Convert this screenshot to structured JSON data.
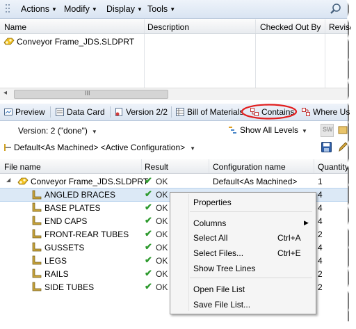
{
  "menubar": {
    "items": [
      {
        "label": "Actions"
      },
      {
        "label": "Modify"
      },
      {
        "label": "Display"
      },
      {
        "label": "Tools"
      }
    ],
    "search_icon": "search-icon"
  },
  "top_list": {
    "columns": [
      "Name",
      "Description",
      "Checked Out By",
      "Revisi"
    ],
    "rows": [
      {
        "name": "Conveyor Frame_JDS.SLDPRT",
        "description": "",
        "checked_out_by": "",
        "revision": ""
      }
    ],
    "scroll_grip": "III"
  },
  "tabs": [
    {
      "label": "Preview",
      "icon": "preview-icon"
    },
    {
      "label": "Data Card",
      "icon": "data-card-icon"
    },
    {
      "label": "Version 2/2",
      "icon": "version-icon"
    },
    {
      "label": "Bill of Materials",
      "icon": "bom-icon"
    },
    {
      "label": "Contains",
      "icon": "contains-icon",
      "active": true
    },
    {
      "label": "Where Us",
      "icon": "where-used-icon"
    }
  ],
  "controls": {
    "version": "Version: 2 (\"done\")",
    "show_levels": "Show All Levels",
    "configuration": "Default<As Machined> <Active Configuration>"
  },
  "bottom_list": {
    "columns": [
      "File name",
      "Result",
      "Configuration name",
      "Quantity"
    ],
    "root": {
      "name": "Conveyor Frame_JDS.SLDPRT",
      "result": "OK",
      "config": "Default<As Machined>",
      "quantity": "1"
    },
    "children": [
      {
        "name": "ANGLED BRACES",
        "result": "OK",
        "quantity": "4",
        "selected": true
      },
      {
        "name": "BASE PLATES",
        "result": "OK",
        "quantity": "4"
      },
      {
        "name": "END CAPS",
        "result": "OK",
        "quantity": "4"
      },
      {
        "name": "FRONT-REAR TUBES",
        "result": "OK",
        "quantity": "2"
      },
      {
        "name": "GUSSETS",
        "result": "OK",
        "quantity": "4"
      },
      {
        "name": "LEGS",
        "result": "OK",
        "quantity": "4"
      },
      {
        "name": "RAILS",
        "result": "OK",
        "quantity": "2"
      },
      {
        "name": "SIDE TUBES",
        "result": "OK",
        "quantity": "2"
      }
    ]
  },
  "context_menu": {
    "items": [
      {
        "label": "Properties",
        "shortcut": ""
      },
      {
        "label": "Columns",
        "shortcut": "",
        "submenu": true
      },
      {
        "label": "Select All",
        "shortcut": "Ctrl+A"
      },
      {
        "label": "Select Files...",
        "shortcut": "Ctrl+E"
      },
      {
        "label": "Show Tree Lines",
        "shortcut": ""
      },
      {
        "label": "Open File List",
        "shortcut": ""
      },
      {
        "label": "Save File List...",
        "shortcut": ""
      }
    ]
  },
  "colors": {
    "accent_highlight": "#e21f1f",
    "selection": "#dce9f6",
    "ok_check": "#2e9a2e"
  }
}
